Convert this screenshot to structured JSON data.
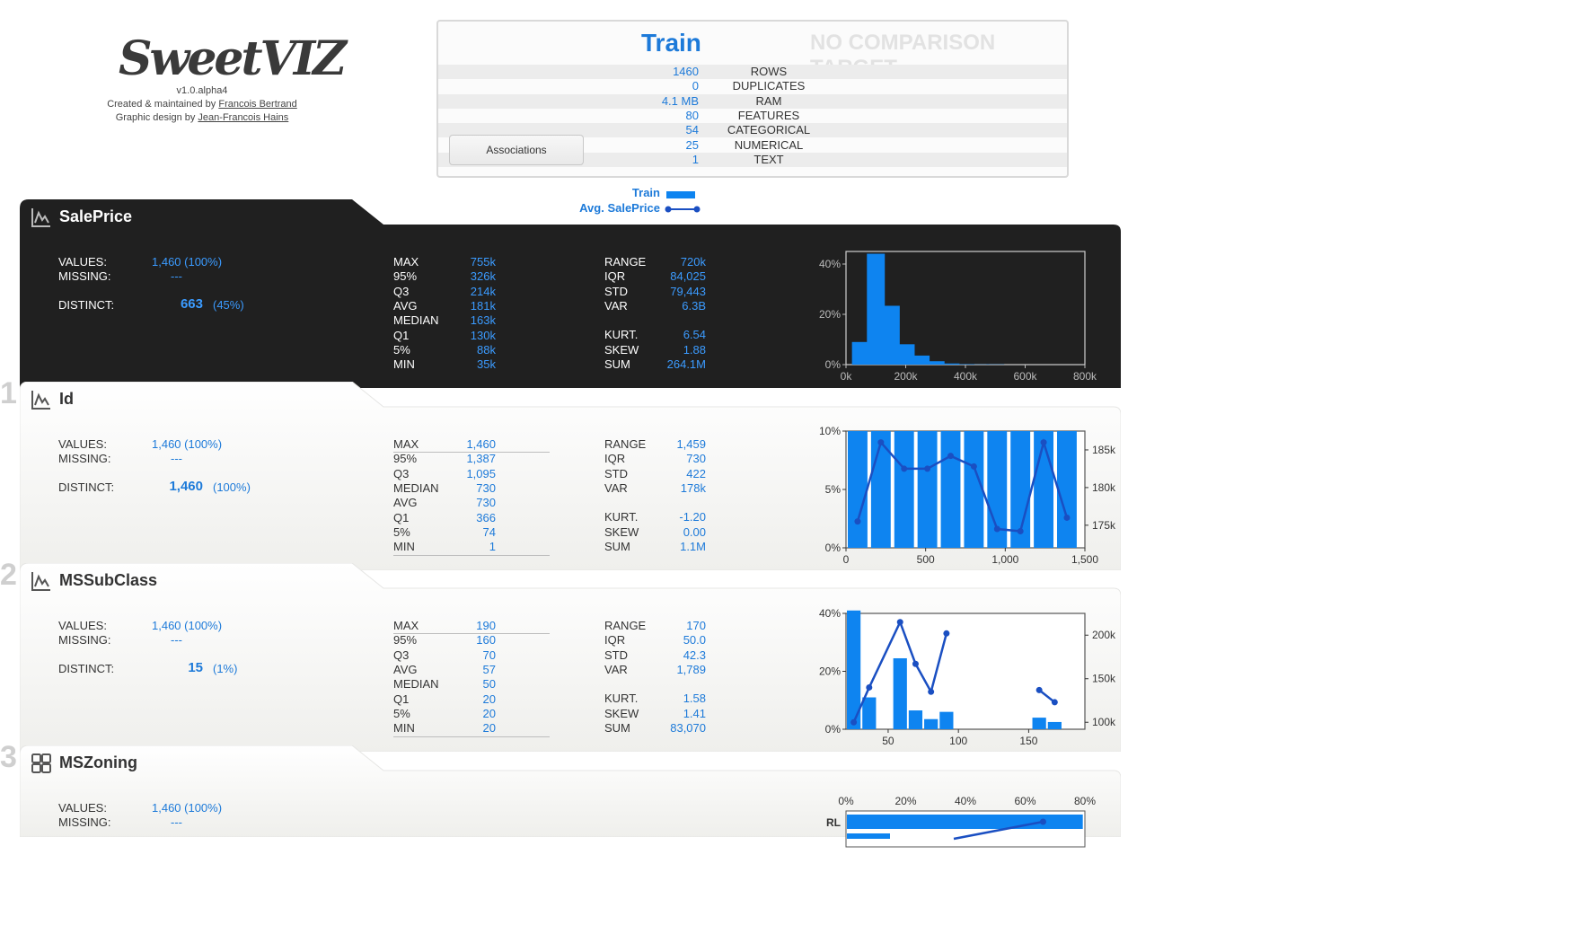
{
  "logo": {
    "text": "SweetVIZ",
    "version": "v1.0.alpha4",
    "created_prefix": "Created & maintained by ",
    "created_author": "Francois Bertrand",
    "design_prefix": "Graphic design by ",
    "design_author": "Jean-Francois Hains"
  },
  "summary": {
    "title": "Train",
    "compare_title": "NO COMPARISON TARGET",
    "rows": [
      {
        "value": "1460",
        "label": "ROWS"
      },
      {
        "value": "0",
        "label": "DUPLICATES"
      },
      {
        "value": "4.1 MB",
        "label": "RAM"
      },
      {
        "value": "80",
        "label": "FEATURES"
      },
      {
        "value": "54",
        "label": "CATEGORICAL"
      },
      {
        "value": "25",
        "label": "NUMERICAL"
      },
      {
        "value": "1",
        "label": "TEXT"
      }
    ],
    "associations_button": "Associations"
  },
  "legend": {
    "train": "Train",
    "avg": "Avg. SalePrice"
  },
  "colors": {
    "accent": "#1d7ad9",
    "bar": "#0e84f0",
    "dark_bg": "#202020",
    "light_bg": "#f7f7f5"
  },
  "features": [
    {
      "index": "",
      "name": "SalePrice",
      "icon": "numeric-chart-icon",
      "values": "1,460 (100%)",
      "missing": "---",
      "distinct": "663",
      "distinct_pct": "(45%)",
      "quantiles": [
        [
          "MAX",
          "755k"
        ],
        [
          "95%",
          "326k"
        ],
        [
          "Q3",
          "214k"
        ],
        [
          "AVG",
          "181k"
        ],
        [
          "MEDIAN",
          "163k"
        ],
        [
          "Q1",
          "130k"
        ],
        [
          "5%",
          "88k"
        ],
        [
          "MIN",
          "35k"
        ]
      ],
      "stats": [
        [
          "RANGE",
          "720k"
        ],
        [
          "IQR",
          "84,025"
        ],
        [
          "STD",
          "79,443"
        ],
        [
          "VAR",
          "6.3B"
        ],
        [
          "KURT.",
          "6.54"
        ],
        [
          "SKEW",
          "1.88"
        ],
        [
          "SUM",
          "264.1M"
        ]
      ]
    },
    {
      "index": "1",
      "name": "Id",
      "icon": "numeric-chart-icon",
      "values": "1,460 (100%)",
      "missing": "---",
      "distinct": "1,460",
      "distinct_pct": "(100%)",
      "quantiles": [
        [
          "MAX",
          "1,460"
        ],
        [
          "95%",
          "1,387"
        ],
        [
          "Q3",
          "1,095"
        ],
        [
          "MEDIAN",
          "730"
        ],
        [
          "AVG",
          "730"
        ],
        [
          "Q1",
          "366"
        ],
        [
          "5%",
          "74"
        ],
        [
          "MIN",
          "1"
        ]
      ],
      "stats": [
        [
          "RANGE",
          "1,459"
        ],
        [
          "IQR",
          "730"
        ],
        [
          "STD",
          "422"
        ],
        [
          "VAR",
          "178k"
        ],
        [
          "KURT.",
          "-1.20"
        ],
        [
          "SKEW",
          "0.00"
        ],
        [
          "SUM",
          "1.1M"
        ]
      ]
    },
    {
      "index": "2",
      "name": "MSSubClass",
      "icon": "numeric-chart-icon",
      "values": "1,460 (100%)",
      "missing": "---",
      "distinct": "15",
      "distinct_pct": "(1%)",
      "quantiles": [
        [
          "MAX",
          "190"
        ],
        [
          "95%",
          "160"
        ],
        [
          "Q3",
          "70"
        ],
        [
          "AVG",
          "57"
        ],
        [
          "MEDIAN",
          "50"
        ],
        [
          "Q1",
          "20"
        ],
        [
          "5%",
          "20"
        ],
        [
          "MIN",
          "20"
        ]
      ],
      "stats": [
        [
          "RANGE",
          "170"
        ],
        [
          "IQR",
          "50.0"
        ],
        [
          "STD",
          "42.3"
        ],
        [
          "VAR",
          "1,789"
        ],
        [
          "KURT.",
          "1.58"
        ],
        [
          "SKEW",
          "1.41"
        ],
        [
          "SUM",
          "83,070"
        ]
      ]
    },
    {
      "index": "3",
      "name": "MSZoning",
      "icon": "categorical-grid-icon",
      "values": "1,460 (100%)",
      "missing": "---"
    }
  ],
  "labels": {
    "values": "VALUES:",
    "missing": "MISSING:",
    "distinct": "DISTINCT:"
  },
  "chart_data": [
    {
      "type": "bar",
      "feature": "SalePrice",
      "x": [
        50000,
        100000,
        150000,
        200000,
        250000,
        300000,
        350000,
        400000,
        450000,
        500000
      ],
      "bin_width": 72000,
      "values": [
        10,
        49,
        26,
        9,
        4,
        1.5,
        0.5,
        0.2,
        0.1,
        0.1
      ],
      "xlim": [
        0,
        800000
      ],
      "ylim": [
        0,
        50
      ],
      "xticks": [
        "0k",
        "200k",
        "400k",
        "600k",
        "800k"
      ],
      "yticks": [
        "0%",
        "20%",
        "40%"
      ]
    },
    {
      "type": "bar",
      "feature": "Id",
      "x": [
        73,
        219,
        365,
        511,
        657,
        803,
        949,
        1095,
        1241,
        1387
      ],
      "bin_width": 146,
      "values": [
        10,
        10,
        10,
        10,
        10,
        10,
        10,
        10,
        10,
        10
      ],
      "line": [
        175500,
        186000,
        182500,
        182500,
        184200,
        182800,
        174500,
        174200,
        186000,
        176000
      ],
      "xlim": [
        0,
        1500
      ],
      "ylim": [
        0,
        10
      ],
      "y2lim": [
        172000,
        187500
      ],
      "xticks": [
        "0",
        "500",
        "1,000",
        "1,500"
      ],
      "yticks": [
        "0%",
        "5%",
        "10%"
      ],
      "y2ticks": [
        "175k",
        "180k",
        "185k"
      ]
    },
    {
      "type": "bar",
      "feature": "MSSubClass",
      "x": [
        20,
        30,
        40,
        45,
        50,
        60,
        70,
        75,
        80,
        85,
        90,
        120,
        150,
        160,
        180,
        190
      ],
      "bins": [
        [
          20,
          31,
          41
        ],
        [
          31,
          42,
          11
        ],
        [
          42,
          53,
          0
        ],
        [
          53,
          64,
          24.5
        ],
        [
          64,
          75,
          6.5
        ],
        [
          75,
          86,
          3.5
        ],
        [
          86,
          97,
          6
        ],
        [
          97,
          108,
          0
        ],
        [
          108,
          119,
          0
        ],
        [
          119,
          130,
          0
        ],
        [
          130,
          141,
          0
        ],
        [
          141,
          152,
          0
        ],
        [
          152,
          163,
          4
        ],
        [
          163,
          174,
          2.5
        ]
      ],
      "line_points": [
        [
          25.5,
          100000
        ],
        [
          36.5,
          140000
        ],
        [
          58.5,
          215000
        ],
        [
          69.5,
          167000
        ],
        [
          80.5,
          135000
        ],
        [
          91.5,
          202000
        ],
        [
          157.5,
          137000
        ],
        [
          168.5,
          123000
        ]
      ],
      "xlim": [
        20,
        190
      ],
      "ylim": [
        0,
        40
      ],
      "y2lim": [
        92000,
        225000
      ],
      "xticks": [
        "50",
        "100",
        "150"
      ],
      "yticks": [
        "0%",
        "20%",
        "40%"
      ],
      "y2ticks": [
        "100k",
        "150k",
        "200k"
      ]
    },
    {
      "type": "bar",
      "feature": "MSZoning",
      "categories": [
        "RL"
      ],
      "values": [
        79
      ],
      "xlim": [
        0,
        80
      ],
      "xticks": [
        "0%",
        "20%",
        "40%",
        "60%",
        "80%"
      ]
    }
  ]
}
